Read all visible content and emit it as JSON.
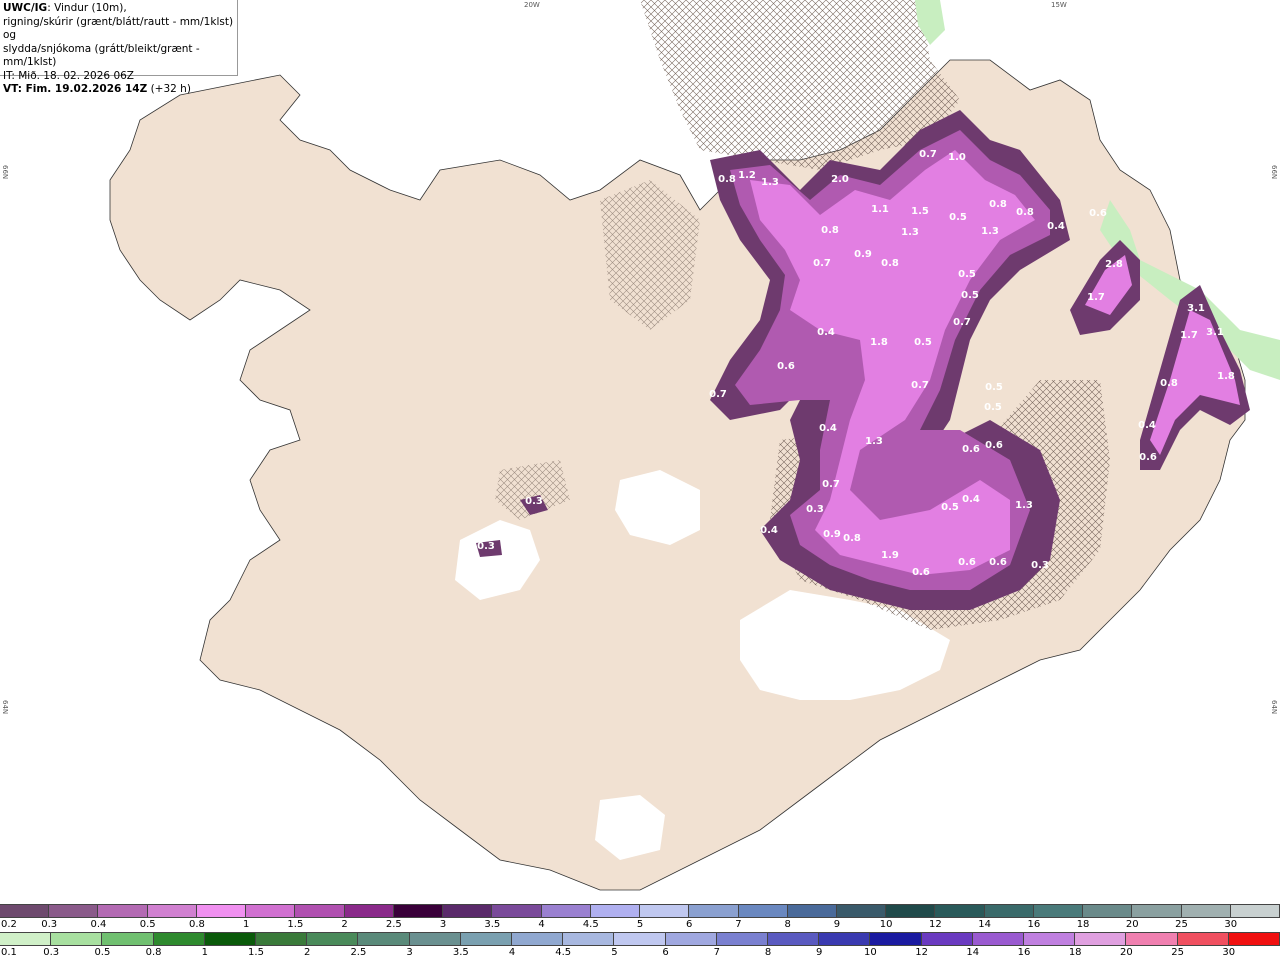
{
  "header": {
    "model": "UWC/IG",
    "desc_line1": ": Vindur (10m),",
    "desc_line2": "rigning/skúrir (grænt/blátt/rautt - mm/1klst) og",
    "desc_line3": "slydda/snjókoma (grátt/bleikt/grænt - mm/1klst)",
    "init_time": "IT: Mið. 18. 02. 2026 06Z",
    "valid_prefix": "VT: Fim. 19.02.2026 14Z",
    "valid_suffix": "(+32 h)"
  },
  "coords": {
    "lon_20w": "20W",
    "lon_15w": "15W",
    "lat_66n_left": "66N",
    "lat_66n_right": "66N",
    "lat_64n_left": "64N",
    "lat_64n_right": "64N"
  },
  "legend": {
    "snow": {
      "labels": [
        "0.2",
        "0.3",
        "0.4",
        "0.5",
        "0.8",
        "1",
        "1.5",
        "2",
        "2.5",
        "3",
        "3.5",
        "4",
        "4.5",
        "5",
        "6",
        "7",
        "8",
        "9",
        "10",
        "12",
        "14",
        "16",
        "18",
        "20",
        "25",
        "30"
      ],
      "colors": [
        "#6e4a6e",
        "#8a5a8a",
        "#b36ab3",
        "#d080d0",
        "#f090f0",
        "#d070d0",
        "#b050b0",
        "#8a2a8a",
        "#3a003a",
        "#5a2a6a",
        "#7a4a9a",
        "#9a80d0",
        "#b0b0f0",
        "#c0c8f0",
        "#8aa0d0",
        "#6a88c0",
        "#4a6a9a",
        "#3a5a6a",
        "#204a4a",
        "#2a5a5a",
        "#3a6a6a",
        "#4a7a7a",
        "#6a8a8a",
        "#8aa0a0",
        "#a0b0b0",
        "#c8d0d0"
      ]
    },
    "rain": {
      "labels": [
        "0.1",
        "0.3",
        "0.5",
        "0.8",
        "1",
        "1.5",
        "2",
        "2.5",
        "3",
        "3.5",
        "4",
        "4.5",
        "5",
        "6",
        "7",
        "8",
        "9",
        "10",
        "12",
        "14",
        "16",
        "18",
        "20",
        "25",
        "30"
      ],
      "colors": [
        "#d0f0c8",
        "#a8e0a0",
        "#70c070",
        "#2e8a2e",
        "#0a5a0a",
        "#3a7a3a",
        "#4a8a5a",
        "#5a8a7a",
        "#6a9090",
        "#7aa0b0",
        "#90a8d0",
        "#a8b8e0",
        "#c0c8f0",
        "#a0a8e0",
        "#7a80d0",
        "#5a5ac0",
        "#3a3ab0",
        "#1a1aa0",
        "#6a3ac0",
        "#9a5ad0",
        "#c080e0",
        "#e0a0e0",
        "#f080b0",
        "#f05060",
        "#f01010"
      ]
    }
  },
  "precip_labels": [
    {
      "v": "0.8"
    },
    {
      "v": "1.2"
    },
    {
      "v": "1.3"
    },
    {
      "v": "2.0"
    },
    {
      "v": "1.1"
    },
    {
      "v": "1.5"
    },
    {
      "v": "0.7"
    },
    {
      "v": "1.0"
    },
    {
      "v": "0.8"
    },
    {
      "v": "1.3"
    },
    {
      "v": "0.5"
    },
    {
      "v": "0.8"
    },
    {
      "v": "0.4"
    },
    {
      "v": "0.8"
    },
    {
      "v": "1.3"
    },
    {
      "v": "0.9"
    },
    {
      "v": "0.8"
    },
    {
      "v": "0.7"
    },
    {
      "v": "0.5"
    },
    {
      "v": "0.5"
    },
    {
      "v": "0.7"
    },
    {
      "v": "0.4"
    },
    {
      "v": "1.8"
    },
    {
      "v": "0.5"
    },
    {
      "v": "0.7"
    },
    {
      "v": "0.6"
    },
    {
      "v": "0.7"
    },
    {
      "v": "0.5"
    },
    {
      "v": "0.5"
    },
    {
      "v": "0.4"
    },
    {
      "v": "1.3"
    },
    {
      "v": "0.6"
    },
    {
      "v": "0.6"
    },
    {
      "v": "0.7"
    },
    {
      "v": "0.4"
    },
    {
      "v": "0.5"
    },
    {
      "v": "1.3"
    },
    {
      "v": "0.3"
    },
    {
      "v": "0.9"
    },
    {
      "v": "0.8"
    },
    {
      "v": "1.9"
    },
    {
      "v": "0.6"
    },
    {
      "v": "0.6"
    },
    {
      "v": "0.6"
    },
    {
      "v": "0.3"
    },
    {
      "v": "0.4"
    },
    {
      "v": "0.3"
    },
    {
      "v": "0.3"
    },
    {
      "v": "0.6"
    },
    {
      "v": "2.8"
    },
    {
      "v": "1.7"
    },
    {
      "v": "3.1"
    },
    {
      "v": "1.7"
    },
    {
      "v": "3.1"
    },
    {
      "v": "0.8"
    },
    {
      "v": "1.8"
    },
    {
      "v": "0.4"
    },
    {
      "v": "0.6"
    }
  ]
}
